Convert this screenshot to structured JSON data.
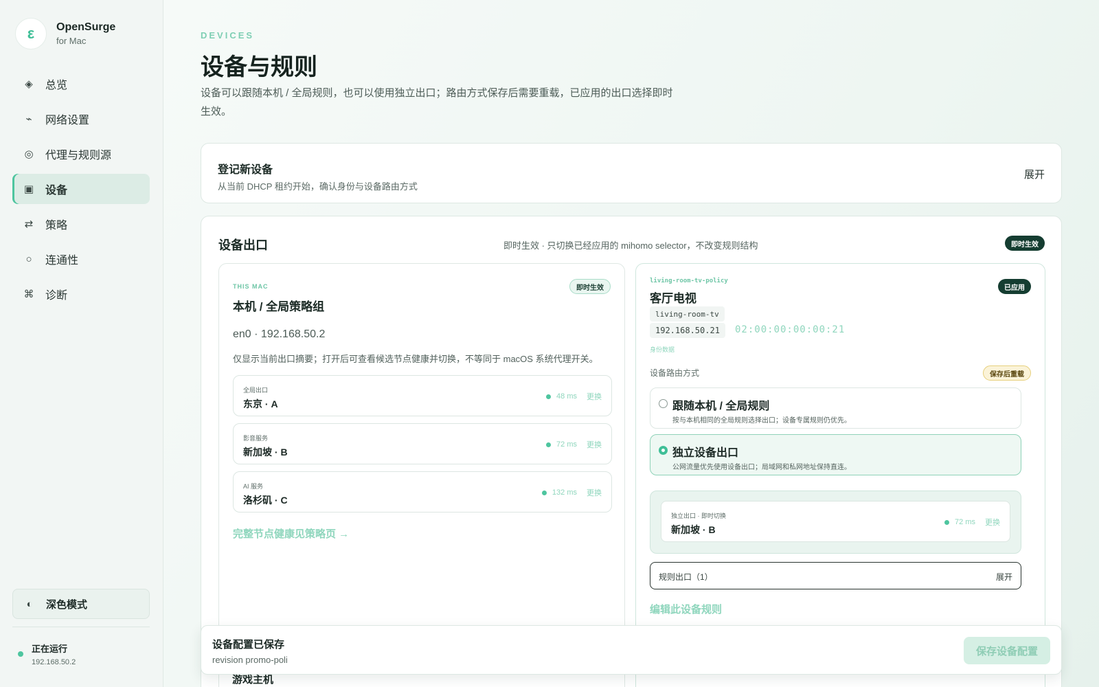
{
  "brand": {
    "name": "OpenSurge",
    "sub": "for Mac",
    "logo_icon": "ε"
  },
  "sidebar": {
    "items": [
      {
        "label": "总览",
        "icon": "◈"
      },
      {
        "label": "网络设置",
        "icon": "⌁"
      },
      {
        "label": "代理与规则源",
        "icon": "◎"
      },
      {
        "label": "设备",
        "icon": "▣",
        "active": true
      },
      {
        "label": "策略",
        "icon": "⇄"
      },
      {
        "label": "连通性",
        "icon": "○"
      },
      {
        "label": "诊断",
        "icon": "⌘"
      }
    ],
    "dark_mode": {
      "label": "深色模式",
      "icon": "◐"
    },
    "status": {
      "title": "正在运行",
      "ip": "192.168.50.2"
    }
  },
  "header": {
    "eyebrow": "DEVICES",
    "title": "设备与规则",
    "description": "设备可以跟随本机 / 全局规则，也可以使用独立出口；路由方式保存后需要重载，已应用的出口选择即时生效。"
  },
  "register": {
    "title": "登记新设备",
    "subtitle": "从当前 DHCP 租约开始，确认身份与设备路由方式",
    "expand": "展开"
  },
  "exits": {
    "title": "设备出口",
    "description": "即时生效 · 只切换已经应用的 mihomo selector，不改变规则结构",
    "badge": "即时生效",
    "mac": {
      "eyebrow": "THIS MAC",
      "title": "本机 / 全局策略组",
      "badge": "即时生效",
      "ip": "en0 · 192.168.50.2",
      "note": "仅显示当前出口摘要；打开后可查看候选节点健康并切换，不等同于 macOS 系统代理开关。",
      "routes": [
        {
          "label": "全局出口",
          "value": "东京 · A",
          "latency": "48 ms",
          "action": "更换"
        },
        {
          "label": "影音服务",
          "value": "新加坡 · B",
          "latency": "72 ms",
          "action": "更换"
        },
        {
          "label": "AI 服务",
          "value": "洛杉矶 · C",
          "latency": "132 ms",
          "action": "更换"
        }
      ],
      "link": "完整节点健康见策略页 →"
    },
    "device": {
      "eyebrow": "living-room-tv-policy",
      "title": "客厅电视",
      "badge": "已应用",
      "hostname": "living-room-tv",
      "ip": "192.168.50.21",
      "mac": "02:00:00:00:00:21",
      "tiny_link": "身份数据",
      "mode_label": "设备路由方式",
      "mode_badge": "保存后重载",
      "options": [
        {
          "title": "跟随本机 / 全局规则",
          "desc": "按与本机相同的全局规则选择出口；设备专属规则仍优先。"
        },
        {
          "title": "独立设备出口",
          "desc": "公网流量优先使用设备出口；局域网和私网地址保持直连。",
          "selected": true
        }
      ],
      "exit_route": {
        "label": "独立出口 · 即时切换",
        "value": "新加坡 · B",
        "latency": "72 ms",
        "action": "更换"
      },
      "rules": {
        "label": "规则出口（1）",
        "expand": "展开"
      },
      "edit_link": "编辑此设备规则"
    },
    "peek_title": "游戏主机"
  },
  "savebar": {
    "title": "设备配置已保存",
    "subtitle": "revision promo-poli",
    "button": "保存设备配置"
  }
}
